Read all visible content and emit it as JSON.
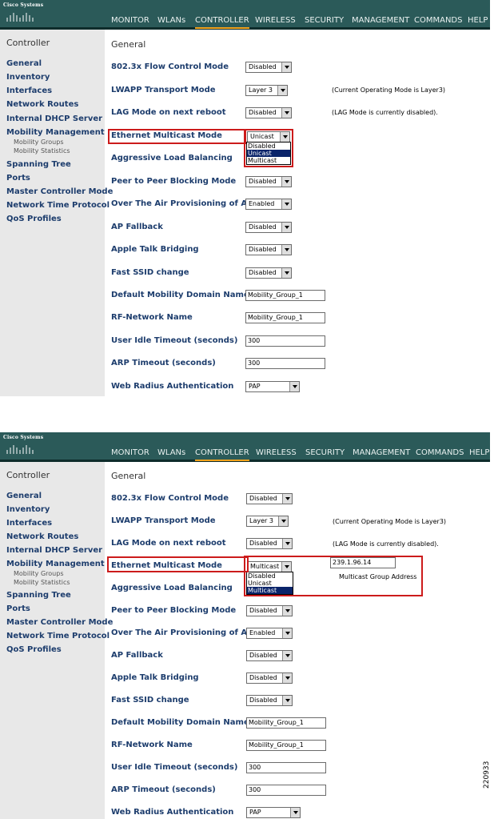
{
  "brand": {
    "logo_text": "Cisco Systems"
  },
  "menu": [
    "MONITOR",
    "WLANs",
    "CONTROLLER",
    "WIRELESS",
    "SECURITY",
    "MANAGEMENT",
    "COMMANDS",
    "HELP"
  ],
  "sidebar": {
    "title": "Controller",
    "items": [
      "General",
      "Inventory",
      "Interfaces",
      "Network Routes",
      "Internal DHCP Server",
      "Mobility Management",
      "Spanning Tree",
      "Ports",
      "Master Controller Mode",
      "Network Time Protocol",
      "QoS Profiles"
    ],
    "subitems": [
      "Mobility Groups",
      "Mobility Statistics"
    ]
  },
  "page": {
    "title": "General"
  },
  "rows": [
    "802.3x Flow Control Mode",
    "LWAPP Transport Mode",
    "LAG Mode on next reboot",
    "Ethernet Multicast Mode",
    "Aggressive Load Balancing",
    "Peer to Peer Blocking Mode",
    "Over The Air Provisioning of AP",
    "AP Fallback",
    "Apple Talk Bridging",
    "Fast SSID change",
    "Default Mobility Domain Name",
    "RF-Network Name",
    "User Idle Timeout (seconds)",
    "ARP Timeout (seconds)",
    "Web Radius Authentication"
  ],
  "values": {
    "flow_control": "Disabled",
    "lwapp": "Layer 3",
    "lag": "Disabled",
    "peer_to_peer": "Disabled",
    "over_the_air": "Enabled",
    "ap_fallback": "Disabled",
    "apple_talk": "Disabled",
    "fast_ssid": "Disabled",
    "mobility_domain": "Mobility_Group_1",
    "rf_network": "Mobility_Group_1",
    "idle_timeout": "300",
    "arp_timeout": "300",
    "web_radius": "PAP"
  },
  "notes": {
    "lwapp": "(Current Operating Mode is Layer3)",
    "lag": "(LAG Mode is currently disabled)."
  },
  "multicast_options": [
    "Disabled",
    "Unicast",
    "Multicast"
  ],
  "panels": [
    {
      "multicast_value": "Unicast",
      "highlighted_option": "Unicast"
    },
    {
      "multicast_value": "Multicast",
      "highlighted_option": "Multicast",
      "group_address": "239.1.96.14",
      "group_address_label": "Multicast Group Address"
    }
  ],
  "figure_id": "220933",
  "colors": {
    "header": "#2b5a59",
    "active_tab": "#f3a21b",
    "highlight": "#cc1b1b",
    "label": "#1d3d6d",
    "selected_option": "#0a246a"
  }
}
